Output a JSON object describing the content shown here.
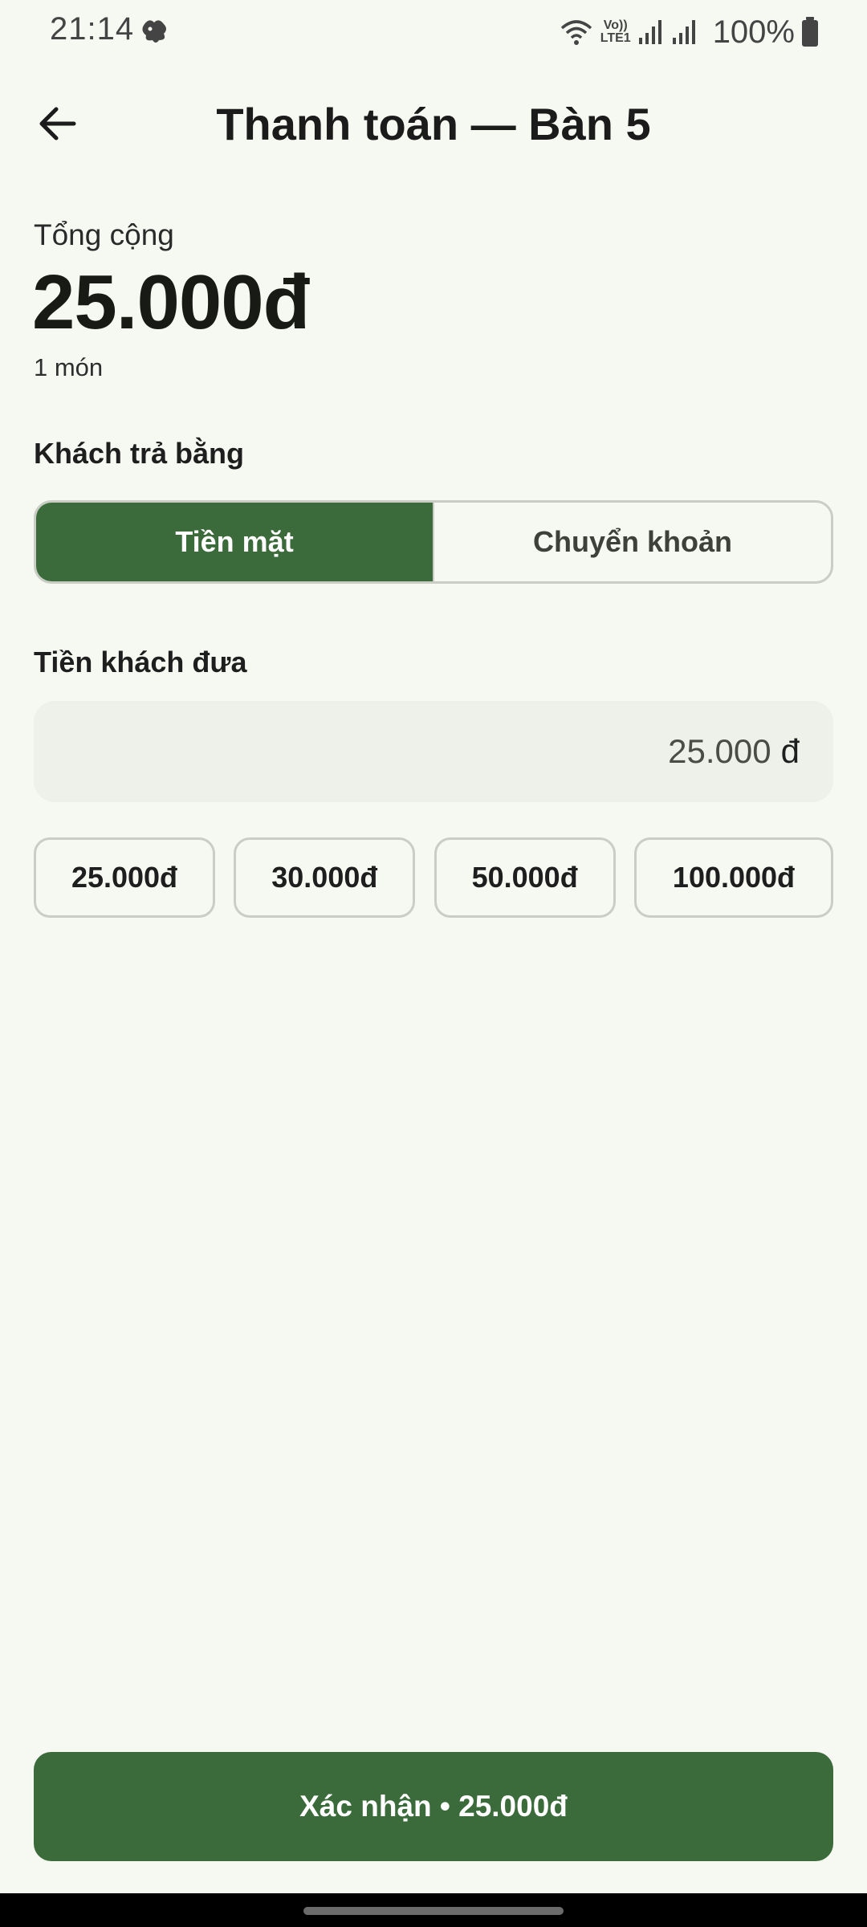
{
  "status_bar": {
    "time": "21:14",
    "network_label_top": "Vo))",
    "network_label_bottom": "LTE1",
    "battery": "100%",
    "icons": [
      "notification-icon",
      "wifi-icon",
      "signal-icon",
      "signal-icon",
      "battery-icon"
    ]
  },
  "app_bar": {
    "back_icon": "arrow-left-icon",
    "title": "Thanh toán — Bàn 5"
  },
  "summary": {
    "total_label": "Tổng cộng",
    "total_amount": "25.000đ",
    "item_count": "1 món"
  },
  "payment_method": {
    "label": "Khách trả bằng",
    "options": [
      "Tiền mặt",
      "Chuyển khoản"
    ],
    "selected": "Tiền mặt"
  },
  "cash_given": {
    "label": "Tiền khách đưa",
    "value": "25.000",
    "currency": "đ"
  },
  "quick_amounts": [
    "25.000đ",
    "30.000đ",
    "50.000đ",
    "100.000đ"
  ],
  "confirm_button": {
    "label": "Xác nhận • 25.000đ"
  },
  "colors": {
    "background": "#f6f9f1",
    "primary": "#3b6a3b",
    "input_bg": "#eef1ea",
    "outline": "#c9cdc4"
  }
}
